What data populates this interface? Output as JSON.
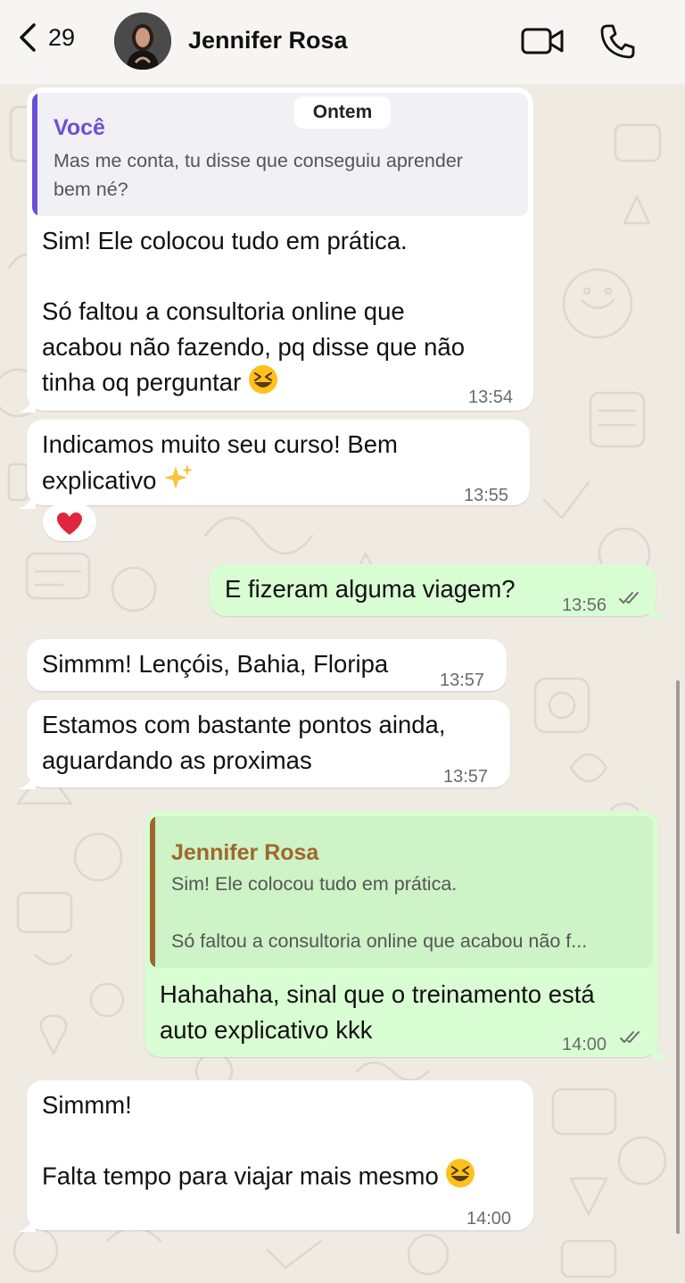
{
  "header": {
    "back_count": "29",
    "contact_name": "Jennifer Rosa"
  },
  "date_separator": "Ontem",
  "messages": [
    {
      "direction": "incoming",
      "quote": {
        "author": "Você",
        "line1": "Mas me conta, tu disse que conseguiu aprender",
        "line2": "bem né?"
      },
      "line1": "Sim! Ele colocou tudo em prática.",
      "line2": "Só faltou a consultoria online que",
      "line3": "acabou não fazendo, pq disse que não",
      "line4": "tinha oq perguntar",
      "emoji": "laughing-face",
      "time": "13:54"
    },
    {
      "direction": "incoming",
      "line1": "Indicamos muito seu curso! Bem",
      "line2": "explicativo",
      "emoji": "sparkles",
      "time": "13:55",
      "reaction": "❤️"
    },
    {
      "direction": "outgoing",
      "line1": "E fizeram alguma viagem?",
      "time": "13:56",
      "status": "read"
    },
    {
      "direction": "incoming",
      "line1": "Simmm! Lençóis, Bahia, Floripa",
      "time": "13:57"
    },
    {
      "direction": "incoming",
      "line1": "Estamos com bastante pontos ainda,",
      "line2": "aguardando as proximas",
      "time": "13:57"
    },
    {
      "direction": "outgoing",
      "quote": {
        "author": "Jennifer Rosa",
        "line1": "Sim! Ele colocou tudo em prática.",
        "line2": "Só faltou a consultoria online que acabou não f..."
      },
      "line1": "Hahahaha, sinal que o treinamento está",
      "line2": "auto explicativo kkk",
      "time": "14:00",
      "status": "read"
    },
    {
      "direction": "incoming",
      "line1": "Simmm!",
      "line2": "Falta tempo para viajar mais mesmo",
      "emoji": "laughing-face",
      "time": "14:00"
    }
  ],
  "colors": {
    "incoming_bubble": "#ffffff",
    "outgoing_bubble": "#d9fdd3",
    "quote_you_accent": "#6b4fd8",
    "quote_contact_accent": "#a0672c",
    "wallpaper": "#efeae2"
  }
}
